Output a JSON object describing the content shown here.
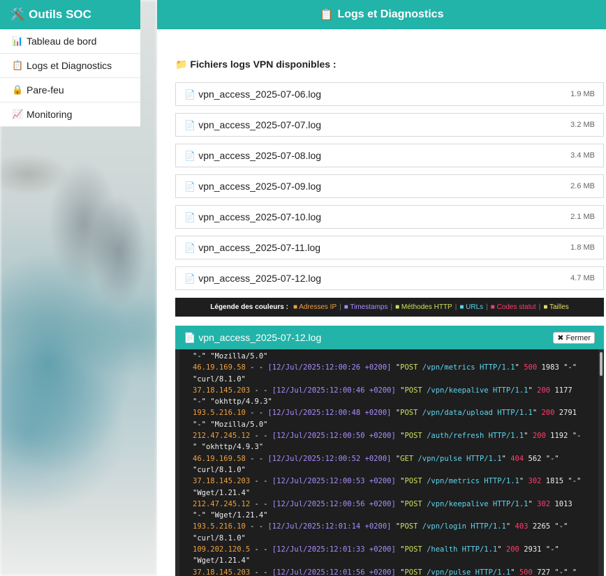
{
  "sidebar": {
    "brand": {
      "icon": "🛠️",
      "label": "Outils SOC"
    },
    "items": [
      {
        "icon": "📊",
        "label": "Tableau de bord"
      },
      {
        "icon": "📋",
        "label": "Logs et Diagnostics"
      },
      {
        "icon": "🔒",
        "label": "Pare-feu"
      },
      {
        "icon": "📈",
        "label": "Monitoring"
      }
    ]
  },
  "header": {
    "icon": "📋",
    "title": "Logs et Diagnostics"
  },
  "files": {
    "icon": "📁",
    "title": "Fichiers logs VPN disponibles :",
    "file_icon": "📄",
    "items": [
      {
        "name": "vpn_access_2025-07-06.log",
        "size": "1.9 MB"
      },
      {
        "name": "vpn_access_2025-07-07.log",
        "size": "3.2 MB"
      },
      {
        "name": "vpn_access_2025-07-08.log",
        "size": "3.4 MB"
      },
      {
        "name": "vpn_access_2025-07-09.log",
        "size": "2.6 MB"
      },
      {
        "name": "vpn_access_2025-07-10.log",
        "size": "2.1 MB"
      },
      {
        "name": "vpn_access_2025-07-11.log",
        "size": "1.8 MB"
      },
      {
        "name": "vpn_access_2025-07-12.log",
        "size": "4.7 MB"
      }
    ]
  },
  "legend": {
    "title": "Légende des couleurs :",
    "bullet": "■",
    "items": [
      {
        "label": "Adresses IP",
        "color": "#f0a040"
      },
      {
        "label": "Timestamps",
        "color": "#a98cff"
      },
      {
        "label": "Méthodes HTTP",
        "color": "#cde25a"
      },
      {
        "label": "URLs",
        "color": "#5ed5ef"
      },
      {
        "label": "Codes statut",
        "color": "#ff3d6e"
      },
      {
        "label": "Tailles",
        "color": "#e8dd6a"
      }
    ]
  },
  "viewer": {
    "file_icon": "📄",
    "title": "vpn_access_2025-07-12.log",
    "close_label": "✖ Fermer",
    "first_line_tail": "\"-\" \"Mozilla/5.0\"",
    "entries": [
      {
        "ip": "46.19.169.58",
        "ts": "12/Jul/2025:12:00:26 +0200",
        "method": "POST",
        "url": "/vpn/metrics",
        "proto": "HTTP/1.1",
        "status": "500",
        "size": "1983",
        "ref": "-",
        "ua": "curl/8.1.0"
      },
      {
        "ip": "37.18.145.203",
        "ts": "12/Jul/2025:12:00:46 +0200",
        "method": "POST",
        "url": "/vpn/keepalive",
        "proto": "HTTP/1.1",
        "status": "200",
        "size": "1177",
        "ref": "-",
        "ua": "okhttp/4.9.3"
      },
      {
        "ip": "193.5.216.10",
        "ts": "12/Jul/2025:12:00:48 +0200",
        "method": "POST",
        "url": "/vpn/data/upload",
        "proto": "HTTP/1.1",
        "status": "200",
        "size": "2791",
        "ref": "-",
        "ua": "Mozilla/5.0"
      },
      {
        "ip": "212.47.245.12",
        "ts": "12/Jul/2025:12:00:50 +0200",
        "method": "POST",
        "url": "/auth/refresh",
        "proto": "HTTP/1.1",
        "status": "200",
        "size": "1192",
        "ref": "-",
        "ua": "okhttp/4.9.3"
      },
      {
        "ip": "46.19.169.58",
        "ts": "12/Jul/2025:12:00:52 +0200",
        "method": "GET",
        "url": "/vpn/pulse",
        "proto": "HTTP/1.1",
        "status": "404",
        "size": "562",
        "ref": "-",
        "ua": "curl/8.1.0"
      },
      {
        "ip": "37.18.145.203",
        "ts": "12/Jul/2025:12:00:53 +0200",
        "method": "POST",
        "url": "/vpn/metrics",
        "proto": "HTTP/1.1",
        "status": "302",
        "size": "1815",
        "ref": "-",
        "ua": "Wget/1.21.4"
      },
      {
        "ip": "212.47.245.12",
        "ts": "12/Jul/2025:12:00:56 +0200",
        "method": "POST",
        "url": "/vpn/keepalive",
        "proto": "HTTP/1.1",
        "status": "302",
        "size": "1013",
        "ref": "-",
        "ua": "Wget/1.21.4"
      },
      {
        "ip": "193.5.216.10",
        "ts": "12/Jul/2025:12:01:14 +0200",
        "method": "POST",
        "url": "/vpn/login",
        "proto": "HTTP/1.1",
        "status": "403",
        "size": "2265",
        "ref": "-",
        "ua": "curl/8.1.0"
      },
      {
        "ip": "109.202.120.5",
        "ts": "12/Jul/2025:12:01:33 +0200",
        "method": "POST",
        "url": "/health",
        "proto": "HTTP/1.1",
        "status": "200",
        "size": "2931",
        "ref": "-",
        "ua": "Wget/1.21.4"
      },
      {
        "ip": "37.18.145.203",
        "ts": "12/Jul/2025:12:01:56 +0200",
        "method": "POST",
        "url": "/vpn/pulse",
        "proto": "HTTP/1.1",
        "status": "500",
        "size": "727",
        "ref": "-",
        "ua": ""
      }
    ]
  }
}
